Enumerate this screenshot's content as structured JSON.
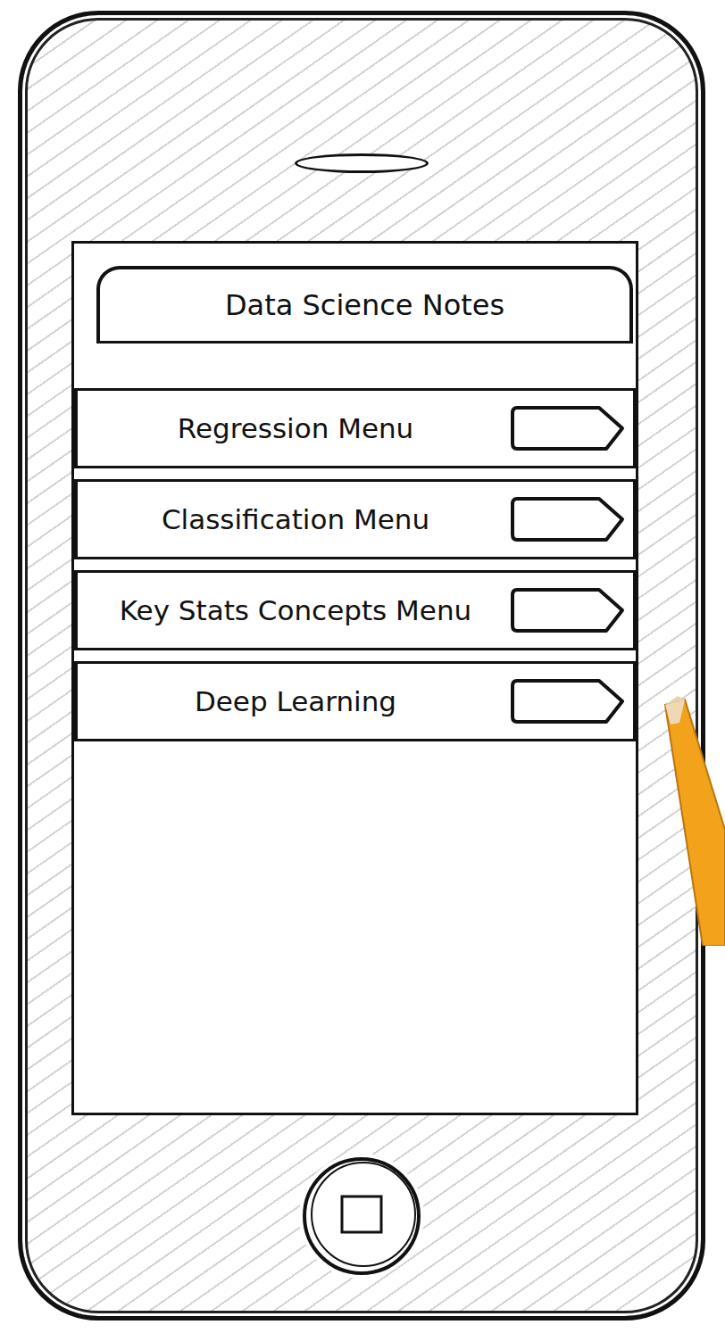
{
  "title": "Data Science Notes",
  "menu": [
    {
      "label": "Regression Menu"
    },
    {
      "label": "Classification Menu"
    },
    {
      "label": "Key Stats Concepts Menu"
    },
    {
      "label": "Deep Learning"
    }
  ]
}
